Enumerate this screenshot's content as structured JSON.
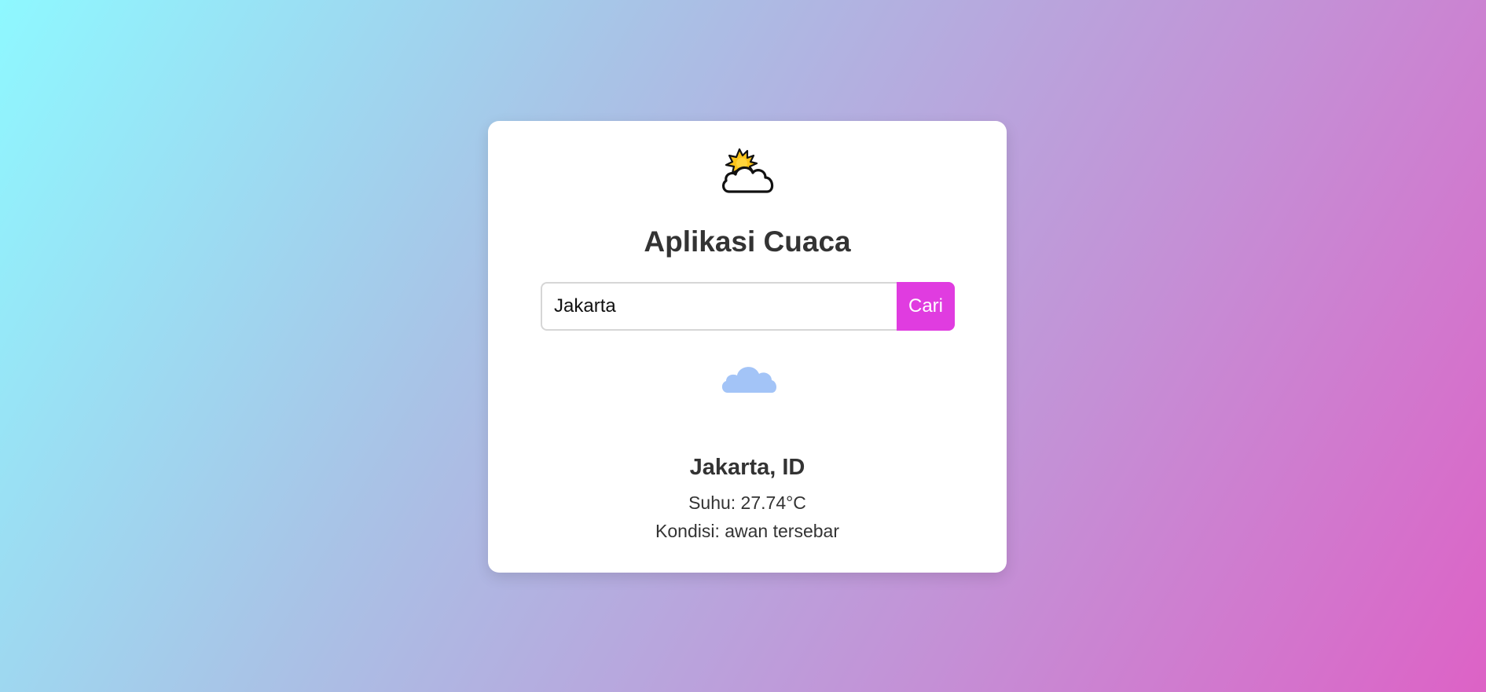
{
  "app": {
    "title": "Aplikasi Cuaca",
    "header_icon": "sun-behind-cloud-icon"
  },
  "search": {
    "value": "Jakarta",
    "button_label": "Cari"
  },
  "weather": {
    "icon": "cloud-icon",
    "location": "Jakarta, ID",
    "temperature": "Suhu: 27.74°C",
    "condition": "Kondisi: awan tersebar"
  },
  "colors": {
    "button": "#e03ce0",
    "cloud": "#a3c4f7",
    "text": "#333333",
    "gradient_start": "#8ef8ff",
    "gradient_end": "#dd62c6"
  }
}
